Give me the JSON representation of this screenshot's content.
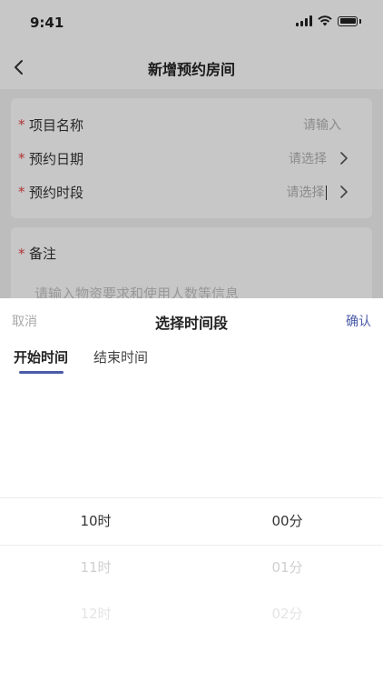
{
  "status_bar": {
    "time": "9:41"
  },
  "nav": {
    "title": "新增预约房间"
  },
  "form": {
    "project_name": {
      "label": "项目名称",
      "placeholder": "请输入"
    },
    "booking_date": {
      "label": "预约日期",
      "placeholder": "请选择"
    },
    "booking_slot": {
      "label": "预约时段",
      "placeholder": "请选择"
    },
    "remarks": {
      "label": "备注",
      "placeholder": "请输入物资要求和使用人数等信息"
    },
    "required_mark": "*"
  },
  "sheet": {
    "cancel_label": "取消",
    "title": "选择时间段",
    "confirm_label": "确认",
    "tabs": [
      {
        "label": "开始时间",
        "active": true
      },
      {
        "label": "结束时间",
        "active": false
      }
    ],
    "hours": [
      "10时",
      "11时",
      "12时"
    ],
    "minutes": [
      "00分",
      "01分",
      "02分"
    ],
    "selected_hour": "10时",
    "selected_minute": "00分"
  },
  "colors": {
    "accent": "#4a5ba8",
    "required": "#e54545",
    "placeholder": "#b3b3b3"
  }
}
